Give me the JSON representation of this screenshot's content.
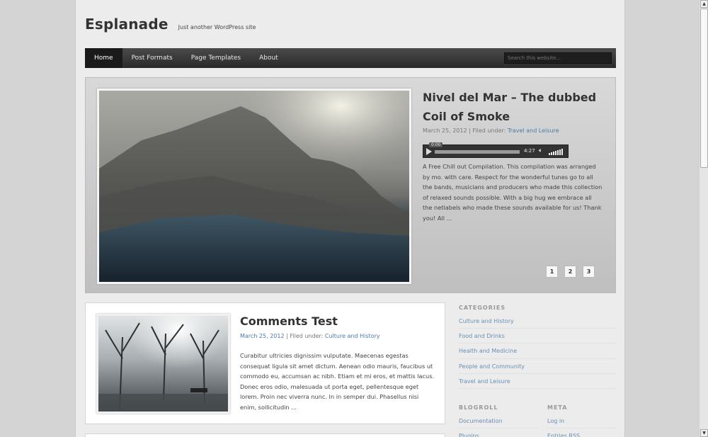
{
  "header": {
    "title": "Esplanade",
    "description": "Just another WordPress site"
  },
  "nav": {
    "items": [
      {
        "label": "Home"
      },
      {
        "label": "Post Formats"
      },
      {
        "label": "Page Templates"
      },
      {
        "label": "About"
      }
    ],
    "search_placeholder": "Search this website..."
  },
  "slider": {
    "title": "Nivel del Mar – The dubbed Coil of Smoke",
    "date": "March 25, 2012",
    "filed_label": "| Filed under:",
    "category": "Travel and Leisure",
    "audio": {
      "current_time": "0:00",
      "duration": "4:27"
    },
    "excerpt": "A Free Chill out Compilation. This compilation was arranged by mo. with care. Respect for the wonderful tunes go to all the bands, musicians and producers who made this collection of relaxed sounds possible. With a big hug we embrace all the netlabels who made these sounds available for us! Thank you! All ...",
    "pages": [
      "1",
      "2",
      "3"
    ]
  },
  "post": {
    "title": "Comments Test",
    "date": "March 25, 2012",
    "filed_label": "| Filed under:",
    "category": "Culture and History",
    "excerpt": "Curabitur ultricies dignissim vulputate. Maecenas egestas consequat ligula sit amet dictum. Aenean odio mauris, faucibus ut commodo eu, accumsan ac nibh. Etiam et mi eros, et mattis lacus. Donec eros odio, malesuada ut porta eget, pellentesque eget lorem. Proin nec viverra nunc. In in semper dui. Phasellus nisi enim, sollicitudin ..."
  },
  "sidebar": {
    "categories": {
      "title": "CATEGORIES",
      "items": [
        "Culture and History",
        "Food and Drinks",
        "Health and Medicine",
        "People and Community",
        "Travel and Leisure"
      ]
    },
    "blogroll": {
      "title": "BLOGROLL",
      "items": [
        "Documentation",
        "Plugins"
      ]
    },
    "meta": {
      "title": "META",
      "items": [
        "Log in",
        "Entries RSS"
      ]
    }
  },
  "colors": {
    "link": "#4a7aa8",
    "nav_bg": "#333333",
    "page_bg": "#ececec"
  },
  "icons": {
    "play": "play-icon",
    "volume": "volume-icon",
    "scroll_up": "arrow-up-icon",
    "scroll_down": "arrow-down-icon"
  }
}
